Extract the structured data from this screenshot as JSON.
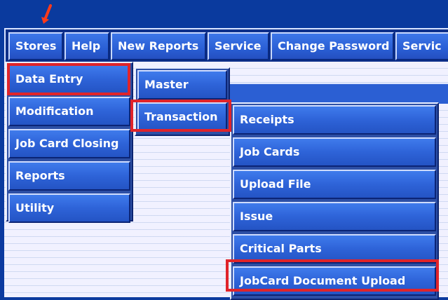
{
  "menubar": {
    "tabs": [
      {
        "label": "Stores"
      },
      {
        "label": "Help"
      },
      {
        "label": "New Reports"
      },
      {
        "label": "Service"
      },
      {
        "label": "Change Password"
      },
      {
        "label": "Servic"
      }
    ]
  },
  "stores_menu": {
    "items": [
      {
        "label": "Data Entry"
      },
      {
        "label": "Modification"
      },
      {
        "label": "Job Card Closing"
      },
      {
        "label": "Reports"
      },
      {
        "label": "Utility"
      }
    ]
  },
  "data_entry_menu": {
    "items": [
      {
        "label": "Master"
      },
      {
        "label": "Transaction"
      }
    ]
  },
  "transaction_menu": {
    "items": [
      {
        "label": "Receipts"
      },
      {
        "label": "Job Cards"
      },
      {
        "label": "Upload File"
      },
      {
        "label": "Issue"
      },
      {
        "label": "Critical Parts"
      },
      {
        "label": "JobCard Document Upload"
      }
    ]
  },
  "colors": {
    "accent": "#2a5fd5",
    "highlight": "#e0242a",
    "background": "#0a3a9e"
  }
}
